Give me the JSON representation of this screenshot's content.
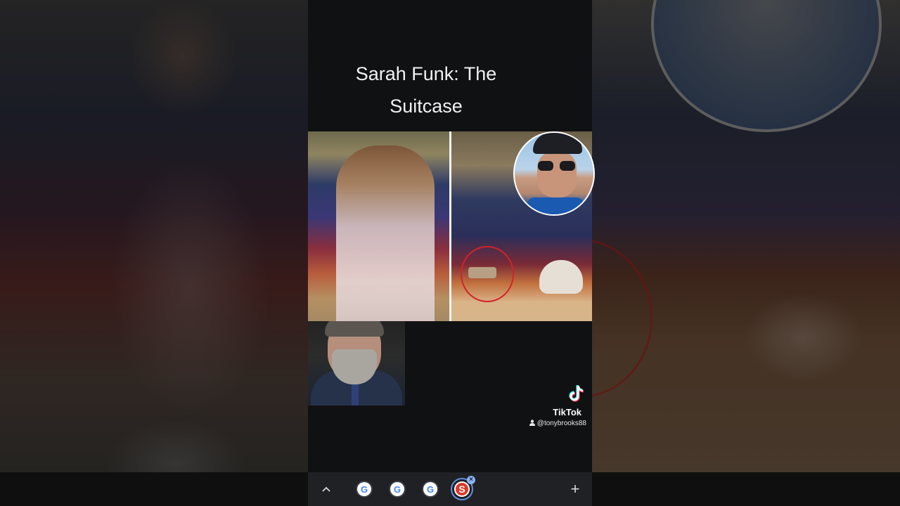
{
  "video": {
    "title_line1": "Sarah Funk: The",
    "title_line2": "Suitcase"
  },
  "watermark": {
    "brand": "TikTok",
    "handle": "@tonybrooks88",
    "logo_icon": "tiktok-logo-icon",
    "user_icon": "person-icon"
  },
  "taskbar": {
    "expand_icon": "chevron-up-icon",
    "apps": [
      {
        "icon": "google-icon",
        "glyph": "G"
      },
      {
        "icon": "google-icon",
        "glyph": "G"
      },
      {
        "icon": "google-icon",
        "glyph": "G"
      }
    ],
    "active_app": {
      "icon": "s-app-icon",
      "glyph": "S"
    },
    "close_glyph": "×",
    "add_glyph": "+"
  },
  "colors": {
    "accent_blue": "#5f8fd6",
    "red_circle": "#d1232a",
    "taskbar_bg": "#1f2125"
  }
}
